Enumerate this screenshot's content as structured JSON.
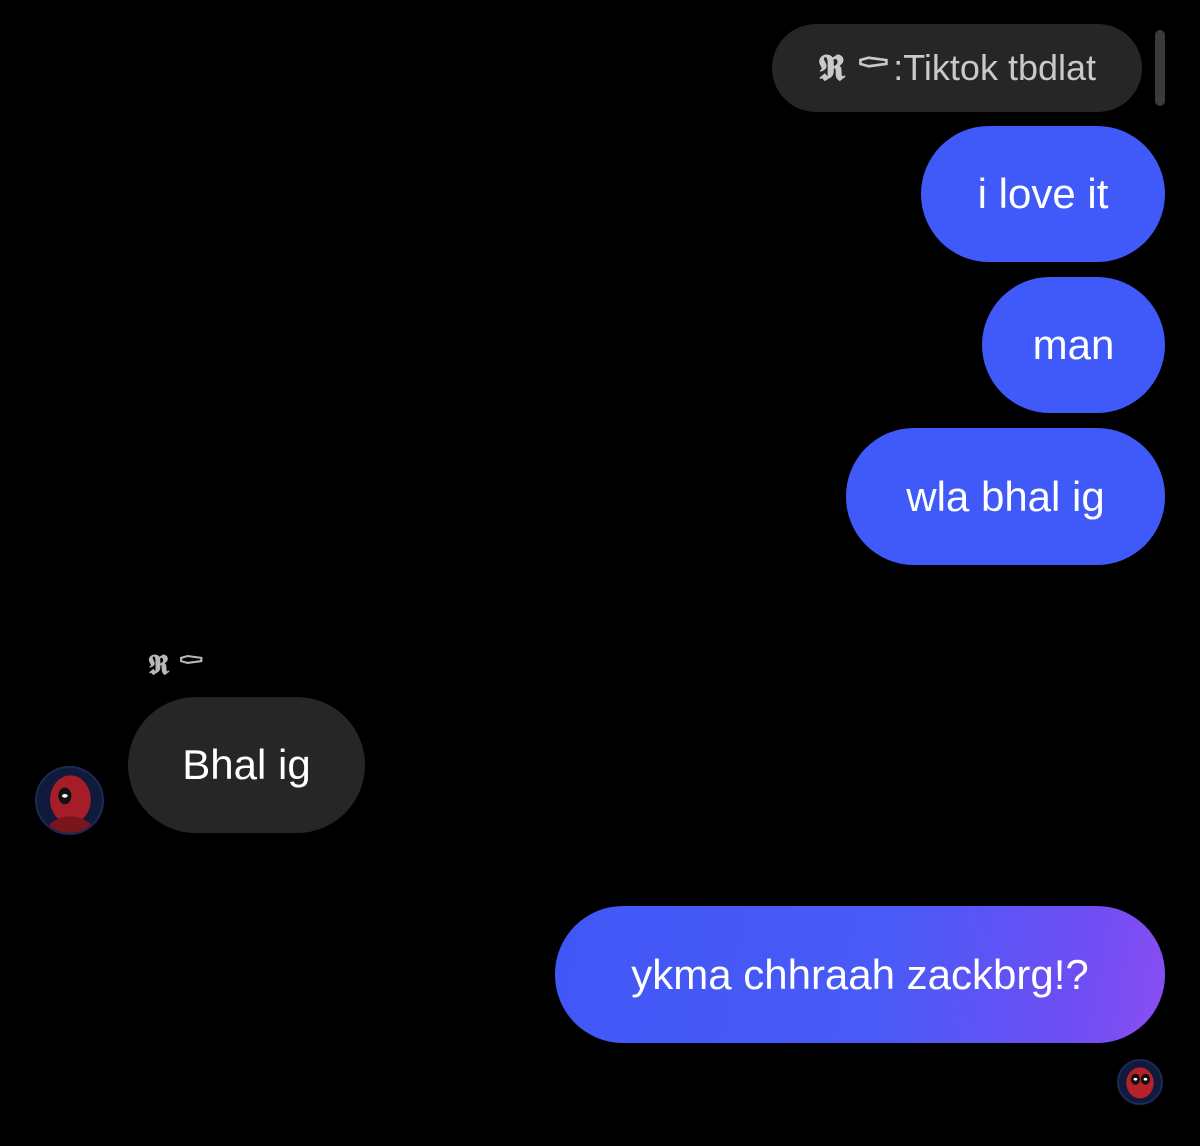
{
  "reply_preview": {
    "sender": "𝕽 ⚰",
    "separator": ": ",
    "text": "Tiktok tbdlat"
  },
  "messages": [
    {
      "direction": "outgoing",
      "text": "i love it"
    },
    {
      "direction": "outgoing",
      "text": "man"
    },
    {
      "direction": "outgoing",
      "text": "wla bhal ig"
    },
    {
      "direction": "incoming",
      "sender": "𝕽 ⚰",
      "text": "Bhal ig"
    },
    {
      "direction": "outgoing",
      "text": "ykma chhraah zackbrg!?"
    }
  ],
  "colors": {
    "background": "#000000",
    "outgoing_bubble": "#3f5af8",
    "incoming_bubble": "#262626",
    "gradient_end": "#8a4ef2"
  },
  "icons": {
    "avatar_incoming": "deadpool-avatar-icon",
    "avatar_read_receipt": "deadpool-avatar-icon"
  }
}
